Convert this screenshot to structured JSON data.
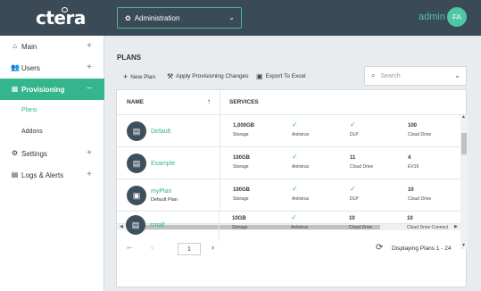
{
  "app": {
    "logo": "ctera"
  },
  "topbar": {
    "context_label": "Administration",
    "user_name": "admin",
    "user_initials": "FA"
  },
  "sidebar": {
    "items": [
      {
        "label": "Main",
        "icon": "home-icon"
      },
      {
        "label": "Users",
        "icon": "users-icon"
      },
      {
        "label": "Provisioning",
        "icon": "grid-icon"
      },
      {
        "label": "Settings",
        "icon": "gear-icon"
      },
      {
        "label": "Logs & Alerts",
        "icon": "clipboard-icon"
      }
    ],
    "sub_items": [
      "Plans",
      "Addons"
    ],
    "expand": "+",
    "collapse": "−"
  },
  "page": {
    "title": "PLANS"
  },
  "toolbar": {
    "new_plan": "New Plan",
    "apply": "Apply Provisioning Changes",
    "export": "Export To Excel",
    "search_placeholder": "Search"
  },
  "table": {
    "col_name": "NAME",
    "col_services": "SERVICES",
    "rows": [
      {
        "name": "Default",
        "desc": "",
        "storage": "1,000GB",
        "storage_cap": "Storage",
        "antivirus_cap": "Antivirus",
        "c3_val": "",
        "c3_cap": "DLP",
        "c4_val": "100",
        "c4_cap": "Cloud Drive"
      },
      {
        "name": "Example",
        "desc": "",
        "storage": "100GB",
        "storage_cap": "Storage",
        "antivirus_cap": "Antivirus",
        "c3_val": "11",
        "c3_cap": "Cloud Drive",
        "c4_val": "4",
        "c4_cap": "EV16"
      },
      {
        "name": "myPlan",
        "desc": "Default Plan",
        "storage": "100GB",
        "storage_cap": "Storage",
        "antivirus_cap": "Antivirus",
        "c3_val": "",
        "c3_cap": "DLP",
        "c4_val": "10",
        "c4_cap": "Cloud Drive"
      },
      {
        "name": "small",
        "desc": "",
        "storage": "10GB",
        "storage_cap": "Storage",
        "antivirus_cap": "Antivirus",
        "c3_val": "10",
        "c3_cap": "Cloud Drive",
        "c4_val": "10",
        "c4_cap": "Cloud Drive Connect"
      }
    ]
  },
  "pager": {
    "page": "1",
    "status": "Displaying Plans 1 - 24"
  }
}
